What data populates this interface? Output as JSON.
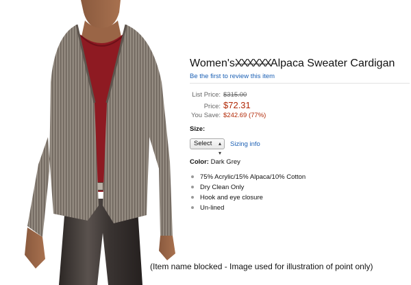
{
  "product": {
    "title_prefix": "Women's",
    "title_blocked": "XXXXXX",
    "title_suffix": "Alpaca Sweater Cardigan",
    "review_link": "Be the first to review this item",
    "image_alt": "Woman wearing grey rib-knit cardigan over red top and dark leather pants"
  },
  "pricing": {
    "list_label": "List Price:",
    "list_value": "$315.00",
    "price_label": "Price:",
    "price_value": "$72.31",
    "save_label": "You Save:",
    "save_value": "$242.69 (77%)"
  },
  "size": {
    "label": "Size:",
    "selected": "Select",
    "sizing_link": "Sizing info"
  },
  "color": {
    "label": "Color:",
    "value": "Dark Grey"
  },
  "features": [
    "75% Acrylic/15% Alpaca/10% Cotton",
    "Dry Clean Only",
    "Hook and eye closure",
    "Un-lined"
  ],
  "footnote": "(Item name blocked - Image used for illustration of point only)",
  "colors": {
    "price_red": "#b12704",
    "link_blue": "#1a5fb4",
    "sweater": "#8a8076",
    "top": "#8e1a22",
    "pants": "#3a3432"
  }
}
